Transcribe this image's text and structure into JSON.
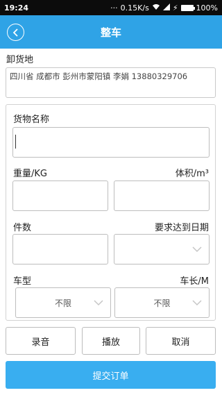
{
  "status_bar": {
    "time": "19:24",
    "speed": "0.15K/s",
    "battery": "100%",
    "icons": [
      "dots-icon",
      "wifi-icon",
      "signal-icon",
      "charging-icon",
      "battery-icon"
    ]
  },
  "header": {
    "title": "整车",
    "back_icon": "chevron-left-icon",
    "color": "#2fa3e6"
  },
  "unload": {
    "label": "卸货地",
    "address": "四川省 成都市 彭州市蒙阳镇 李娟 13880329706"
  },
  "form": {
    "goods_name_label": "货物名称",
    "goods_name_value": "",
    "weight_label": "重量/KG",
    "weight_value": "",
    "volume_label": "体积/m³",
    "volume_value": "",
    "pieces_label": "件数",
    "pieces_value": "",
    "required_date_label": "要求达到日期",
    "required_date_value": "",
    "vehicle_type_label": "车型",
    "vehicle_type_value": "不限",
    "vehicle_length_label": "车长/M",
    "vehicle_length_value": "不限"
  },
  "actions": {
    "record_label": "录音",
    "play_label": "播放",
    "cancel_label": "取消",
    "submit_label": "提交订单",
    "submit_color": "#39aef0"
  }
}
